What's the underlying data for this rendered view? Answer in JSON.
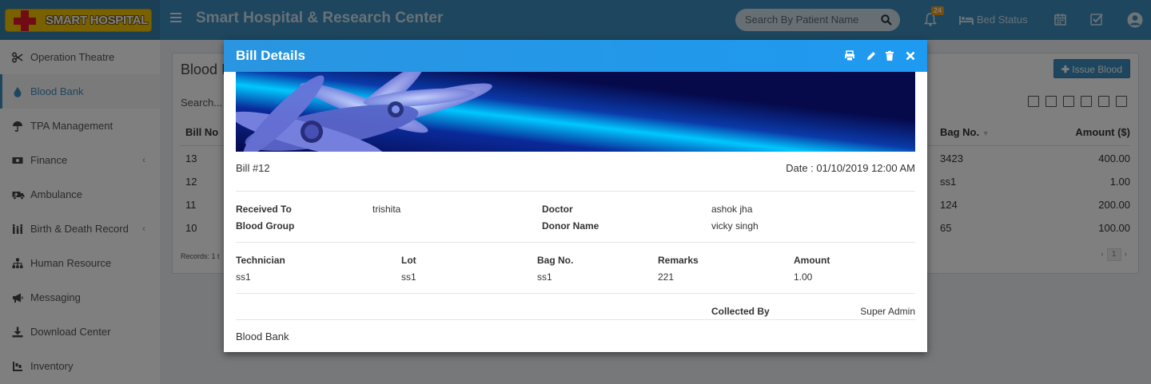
{
  "header": {
    "logo_text": "SMART HOSPITAL",
    "app_title": "Smart Hospital & Research Center",
    "search_placeholder": "Search By Patient Name",
    "notification_count": "24",
    "bed_status_label": "Bed Status"
  },
  "sidebar": {
    "items": [
      {
        "label": "Operation Theatre",
        "icon": "scissors-icon"
      },
      {
        "label": "Blood Bank",
        "icon": "tint-icon",
        "active": true
      },
      {
        "label": "TPA Management",
        "icon": "umbrella-icon"
      },
      {
        "label": "Finance",
        "icon": "money-icon",
        "chevron": true
      },
      {
        "label": "Ambulance",
        "icon": "ambulance-icon"
      },
      {
        "label": "Birth & Death Record",
        "icon": "family-icon",
        "chevron": true
      },
      {
        "label": "Human Resource",
        "icon": "sitemap-icon"
      },
      {
        "label": "Messaging",
        "icon": "bullhorn-icon"
      },
      {
        "label": "Download Center",
        "icon": "download-icon"
      },
      {
        "label": "Inventory",
        "icon": "inventory-icon"
      }
    ]
  },
  "background_page": {
    "title": "Blood I",
    "issue_button": "Issue Blood",
    "search_placeholder": "Search...",
    "columns": {
      "bill_no": "Bill No",
      "bag_no": "Bag No.",
      "amount": "Amount ($)"
    },
    "rows": [
      {
        "bill_no": "13",
        "bag_no": "3423",
        "amount": "400.00"
      },
      {
        "bill_no": "12",
        "bag_no": "ss1",
        "amount": "1.00"
      },
      {
        "bill_no": "11",
        "bag_no": "124",
        "amount": "200.00"
      },
      {
        "bill_no": "10",
        "bag_no": "65",
        "amount": "100.00"
      }
    ],
    "records_text": "Records: 1 t",
    "pager_current": "1"
  },
  "modal": {
    "title": "Bill Details",
    "bill_number": "Bill #12",
    "date": "Date : 01/10/2019 12:00 AM",
    "received_to_label": "Received To",
    "received_to_value": "trishita",
    "doctor_label": "Doctor",
    "doctor_value": "ashok jha",
    "blood_group_label": "Blood Group",
    "blood_group_value": "",
    "donor_name_label": "Donor Name",
    "donor_name_value": "vicky singh",
    "columns": {
      "technician": "Technician",
      "lot": "Lot",
      "bag_no": "Bag No.",
      "remarks": "Remarks",
      "amount": "Amount"
    },
    "row": {
      "technician": "ss1",
      "lot": "ss1",
      "bag_no": "ss1",
      "remarks": "221",
      "amount": "1.00"
    },
    "collected_by_label": "Collected By",
    "collected_by_value": "Super Admin",
    "footer": "Blood Bank"
  },
  "colors": {
    "header": "#3c8dbc",
    "modal_header": "#1e9af0",
    "banner_dark": "#06094a",
    "banner_glow": "#00c8ff"
  }
}
